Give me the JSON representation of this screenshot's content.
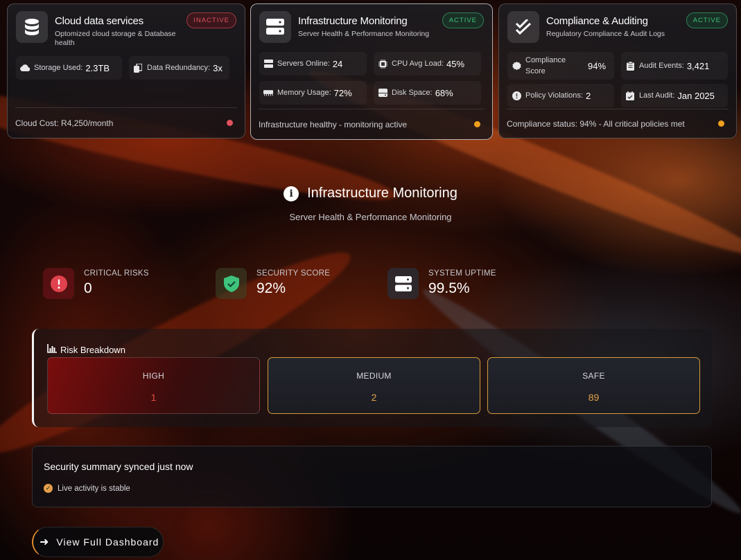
{
  "cards": [
    {
      "title": "Cloud data services",
      "subtitle": "Optomized cloud storage & Database health",
      "status": "INACTIVE",
      "icon": "database-icon",
      "stats": [
        {
          "label": "Storage Used",
          "value": "2.3TB",
          "icon": "cloud-icon"
        },
        {
          "label": "Data Redundancy",
          "value": "3x",
          "icon": "copy-icon"
        }
      ],
      "footer": "Cloud Cost: R4,250/month",
      "dot_color": "#e2525e"
    },
    {
      "title": "Infrastructure Monitoring",
      "subtitle": "Server Health & Performance Monitoring",
      "status": "ACTIVE",
      "icon": "server-icon",
      "stats": [
        {
          "label": "Servers Online",
          "value": "24",
          "icon": "server-icon"
        },
        {
          "label": "CPU Avg Load",
          "value": "45%",
          "icon": "cpu-icon"
        },
        {
          "label": "Memory Usage",
          "value": "72%",
          "icon": "memory-icon"
        },
        {
          "label": "Disk Space",
          "value": "68%",
          "icon": "disk-icon"
        }
      ],
      "footer": "Infrastructure healthy - monitoring active",
      "dot_color": "#f0a01e"
    },
    {
      "title": "Compliance & Auditing",
      "subtitle": "Regulatory Compliance & Audit Logs",
      "status": "ACTIVE",
      "icon": "check-double-icon",
      "stats": [
        {
          "label": "Compliance Score",
          "value": "94%",
          "icon": "badge-check-icon"
        },
        {
          "label": "Audit Events",
          "value": "3,421",
          "icon": "clipboard-icon"
        },
        {
          "label": "Policy Violations",
          "value": "2",
          "icon": "alert-circle-icon"
        },
        {
          "label": "Last Audit",
          "value": "Jan 2025",
          "icon": "calendar-check-icon"
        }
      ],
      "footer": "Compliance status: 94% - All critical policies met",
      "dot_color": "#f0a01e"
    }
  ],
  "detail": {
    "title": "Infrastructure Monitoring",
    "subtitle": "Server Health & Performance Monitoring"
  },
  "metrics": [
    {
      "label": "CRITICAL RISKS",
      "value": "0",
      "icon": "alert-circle-icon",
      "color": "#e0424e"
    },
    {
      "label": "SECURITY SCORE",
      "value": "92%",
      "icon": "shield-check-icon",
      "color": "#3ec27c"
    },
    {
      "label": "SYSTEM UPTIME",
      "value": "99.5%",
      "icon": "server-icon",
      "color": "#ffffff"
    }
  ],
  "risk_breakdown": {
    "title": "Risk Breakdown",
    "items": [
      {
        "label": "HIGH",
        "value": "1"
      },
      {
        "label": "MEDIUM",
        "value": "2"
      },
      {
        "label": "SAFE",
        "value": "89"
      }
    ]
  },
  "summary": {
    "title": "Security summary synced just now",
    "line": "Live activity is stable"
  },
  "cta": {
    "label": "View Full Dashboard"
  }
}
